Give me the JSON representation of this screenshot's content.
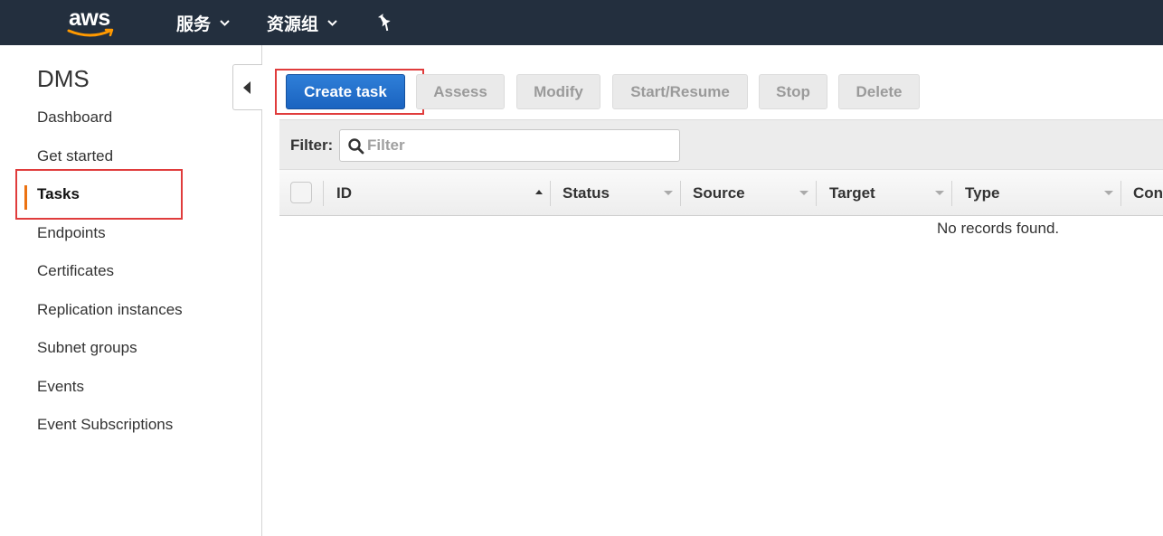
{
  "topbar": {
    "logo_text": "aws",
    "services_label": "服务",
    "resource_groups_label": "资源组"
  },
  "sidebar": {
    "title": "DMS",
    "items": [
      {
        "label": "Dashboard"
      },
      {
        "label": "Get started"
      },
      {
        "label": "Tasks"
      },
      {
        "label": "Endpoints"
      },
      {
        "label": "Certificates"
      },
      {
        "label": "Replication instances"
      },
      {
        "label": "Subnet groups"
      },
      {
        "label": "Events"
      },
      {
        "label": "Event Subscriptions"
      }
    ],
    "active_item": "Tasks"
  },
  "toolbar": {
    "create_task": "Create task",
    "assess": "Assess",
    "modify": "Modify",
    "start_resume": "Start/Resume",
    "stop": "Stop",
    "delete": "Delete"
  },
  "filter": {
    "label": "Filter:",
    "placeholder": "Filter"
  },
  "table": {
    "columns": [
      "ID",
      "Status",
      "Source",
      "Target",
      "Type",
      "Con"
    ],
    "empty_message": "No records found."
  },
  "colors": {
    "topbar": "#232f3e",
    "primary_button": "#1a63c0",
    "active_indicator": "#ec7211",
    "highlight": "#e03c3c"
  }
}
